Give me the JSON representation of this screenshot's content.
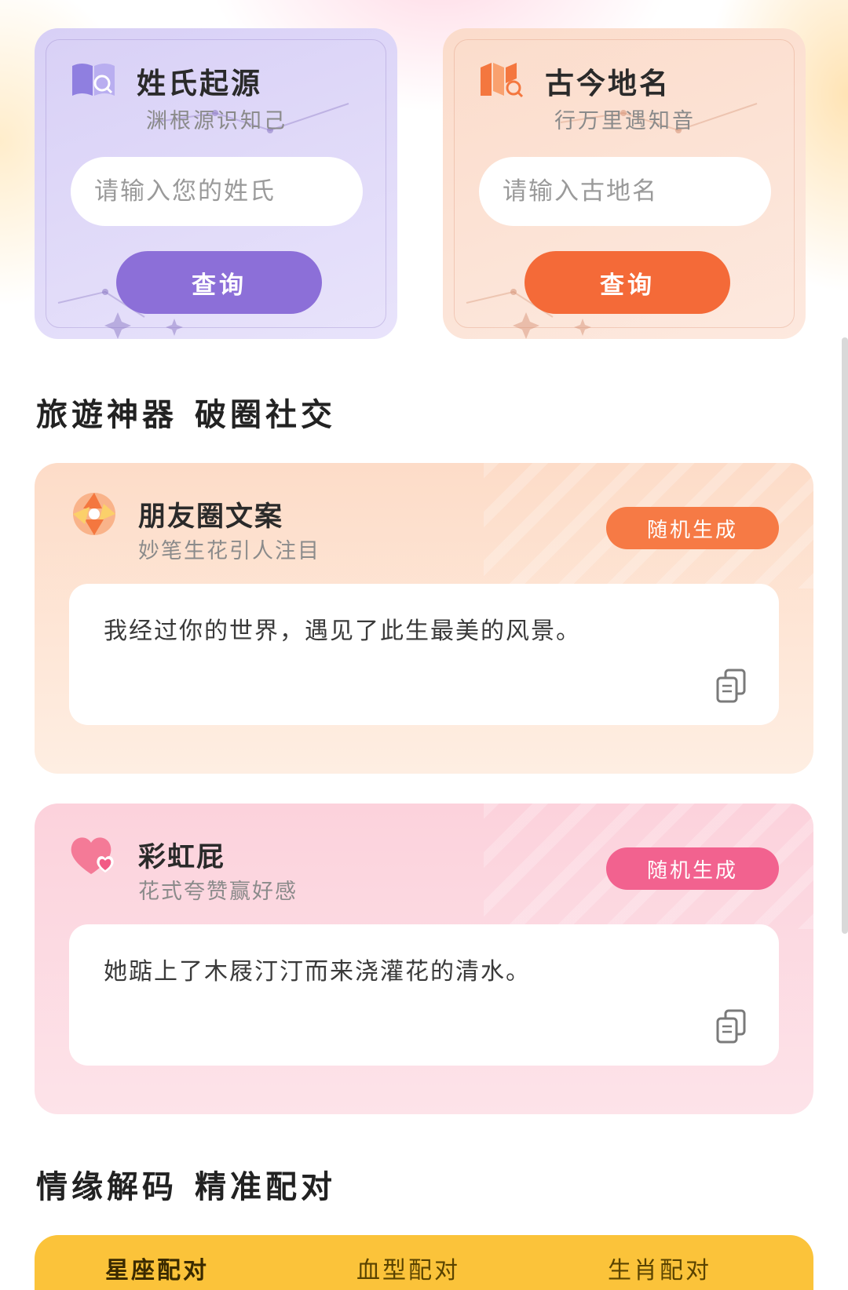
{
  "surname_card": {
    "title": "姓氏起源",
    "subtitle": "渊根源识知己",
    "input_placeholder": "请输入您的姓氏",
    "button_label": "查询",
    "accent": "#8c6fd8"
  },
  "place_card": {
    "title": "古今地名",
    "subtitle": "行万里遇知音",
    "input_placeholder": "请输入古地名",
    "button_label": "查询",
    "accent": "#f46a38"
  },
  "section_travel": {
    "part1": "旅遊神器",
    "part2": "破圈社交"
  },
  "moments_card": {
    "title": "朋友圈文案",
    "subtitle": "妙笔生花引人注目",
    "button_label": "随机生成",
    "text": "我经过你的世界，遇见了此生最美的风景。",
    "icon": "aperture-icon",
    "accent": "#f67a45"
  },
  "rainbow_card": {
    "title": "彩虹屁",
    "subtitle": "花式夸赞赢好感",
    "button_label": "随机生成",
    "text": "她踮上了木屐汀汀而来浇灌花的清水。",
    "icon": "heart-icon",
    "accent": "#f2628f"
  },
  "section_love": {
    "part1": "情缘解码",
    "part2": "精准配对"
  },
  "match_tabs": [
    {
      "label": "星座配对",
      "active": true
    },
    {
      "label": "血型配对",
      "active": false
    },
    {
      "label": "生肖配对",
      "active": false
    }
  ]
}
